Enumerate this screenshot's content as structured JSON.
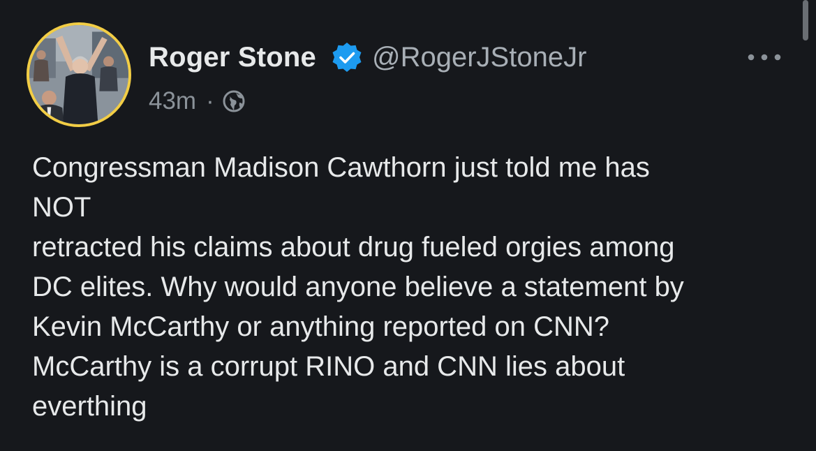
{
  "author": {
    "display_name": "Roger Stone",
    "handle": "@RogerJStoneJr",
    "verified": true,
    "avatar_ring_color": "#f2cd45"
  },
  "meta": {
    "timestamp": "43m",
    "separator": "·",
    "visibility_icon": "globe-icon"
  },
  "icons": {
    "verified": "verified-badge-icon",
    "more": "more-options-icon"
  },
  "colors": {
    "background": "#16181c",
    "verified_badge": "#1d9bf0",
    "text": "#e7e9ea",
    "secondary_text": "#8b9299"
  },
  "tweet": {
    "lines": [
      "Congressman Madison Cawthorn just told me has",
      "NOT",
      "retracted his claims about drug fueled orgies among",
      "DC elites. Why would anyone believe a statement by",
      "Kevin McCarthy or anything reported on CNN?",
      "McCarthy is a corrupt RINO and CNN lies about",
      "everthing"
    ]
  }
}
